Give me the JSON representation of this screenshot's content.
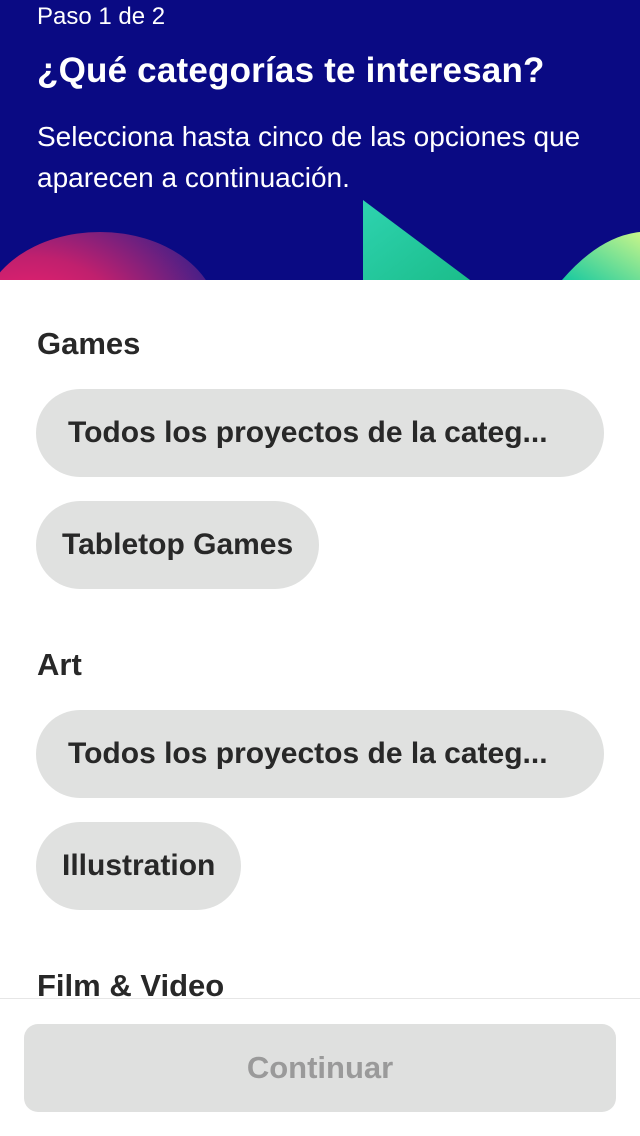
{
  "header": {
    "step": "Paso 1 de 2",
    "title": "¿Qué categorías te interesan?",
    "subtitle": "Selecciona hasta cinco de las opciones que aparecen a continuación.",
    "background_color": "#0a0a83"
  },
  "sections": [
    {
      "heading": "Games",
      "chips": [
        "Todos los proyectos de la categ...",
        "Tabletop Games"
      ]
    },
    {
      "heading": "Art",
      "chips": [
        "Todos los proyectos de la categ...",
        "Illustration"
      ]
    },
    {
      "heading": "Film & Video",
      "chips": []
    }
  ],
  "footer": {
    "continue_label": "Continuar",
    "continue_enabled": false
  },
  "colors": {
    "chip_background": "#e0e1e0",
    "text_dark": "#282828",
    "disabled_button": "#dfe0df",
    "disabled_text": "#9a9a9a"
  }
}
